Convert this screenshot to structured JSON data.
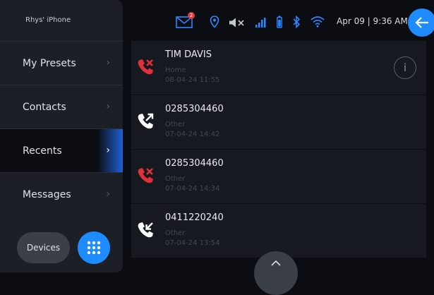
{
  "device": {
    "name": "Rhys' iPhone"
  },
  "menu": {
    "items": [
      {
        "label": "My Presets"
      },
      {
        "label": "Contacts"
      },
      {
        "label": "Recents"
      },
      {
        "label": "Messages"
      }
    ],
    "active": "Recents"
  },
  "footer": {
    "devices_label": "Devices"
  },
  "status": {
    "message_badge": "2",
    "datetime": "Apr 09 | 9:36 AM",
    "icons": [
      "mail-icon",
      "location-icon",
      "mute-icon",
      "signal-icon",
      "battery-icon",
      "bluetooth-icon",
      "wifi-icon",
      "back-arrow-icon"
    ]
  },
  "recents": [
    {
      "name": "TIM DAVIS",
      "type": "Home",
      "time": "08-04-24 11:55",
      "call": "missed",
      "icon_color": "#e0313a"
    },
    {
      "name": "0285304460",
      "type": "Other",
      "time": "07-04-24 14:42",
      "call": "outgoing",
      "icon_color": "#ffffff"
    },
    {
      "name": "0285304460",
      "type": "Other",
      "time": "07-04-24 14:34",
      "call": "missed",
      "icon_color": "#e0313a"
    },
    {
      "name": "0411220240",
      "type": "Other",
      "time": "07-04-24 13:54",
      "call": "incoming",
      "icon_color": "#ffffff"
    }
  ],
  "colors": {
    "accent": "#1e8bff",
    "missed": "#e0313a",
    "panel": "#1c1f25",
    "background": "#0b0d12"
  }
}
